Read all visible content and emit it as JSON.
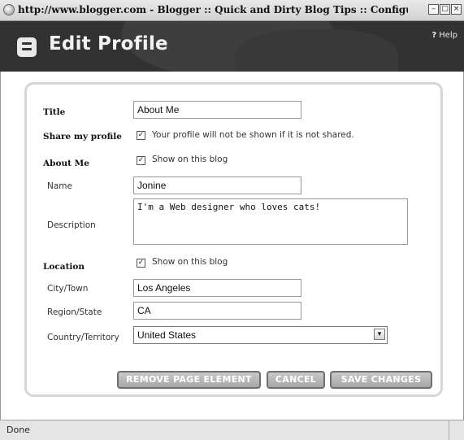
{
  "window": {
    "title": "http://www.blogger.com - Blogger :: Quick and Dirty Blog Tips :: Configure P...",
    "controls": [
      "minimize",
      "maximize",
      "close"
    ]
  },
  "header": {
    "logo_icon": "blogger-logo-icon",
    "title": "Edit Profile",
    "help_mark": "?",
    "help_label": "Help",
    "background_color": "#323232"
  },
  "form": {
    "title": {
      "label": "Title",
      "value": "About Me"
    },
    "share_profile": {
      "label": "Share my profile",
      "checked": true,
      "checkbox_label": "Your profile will not be shown if it is not shared."
    },
    "about_me": {
      "label": "About Me",
      "checked": true,
      "checkbox_label": "Show on this blog",
      "name": {
        "label": "Name",
        "value": "Jonine"
      },
      "description": {
        "label": "Description",
        "value": "I'm a Web designer who loves cats!"
      }
    },
    "location": {
      "label": "Location",
      "checked": true,
      "checkbox_label": "Show on this blog",
      "city": {
        "label": "City/Town",
        "value": "Los Angeles"
      },
      "region": {
        "label": "Region/State",
        "value": "CA"
      },
      "country": {
        "label": "Country/Territory",
        "value": "United States"
      }
    },
    "buttons": {
      "remove": "REMOVE PAGE ELEMENT",
      "cancel": "CANCEL",
      "save": "SAVE CHANGES"
    }
  },
  "statusbar": {
    "text": "Done"
  }
}
